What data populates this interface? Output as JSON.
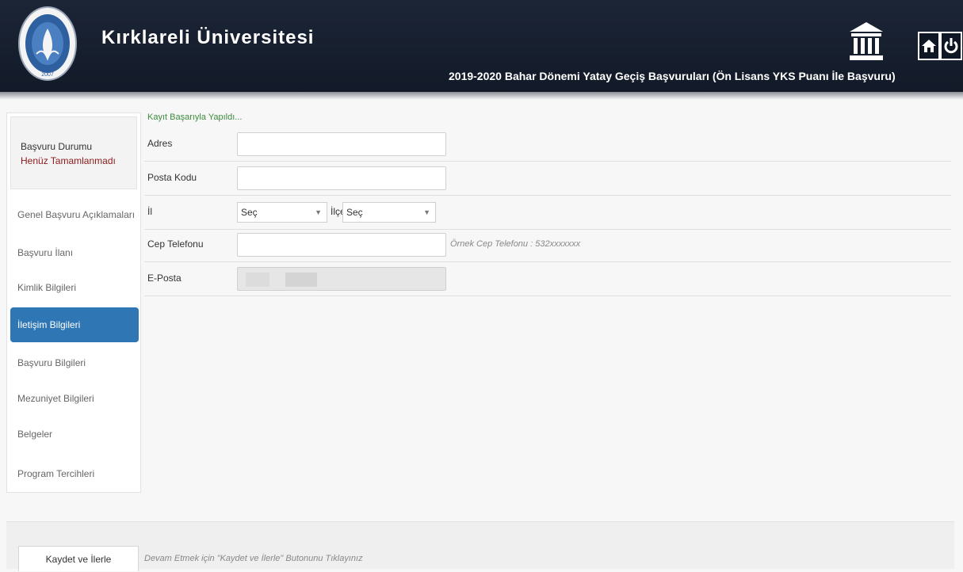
{
  "header": {
    "site_title": "Kırklareli Üniversitesi",
    "application_title": "2019-2020 Bahar Dönemi Yatay Geçiş Başvuruları (Ön Lisans YKS Puanı İle Başvuru)",
    "logo_year": "2007"
  },
  "colors": {
    "header_bg": "#141c2b",
    "active_nav": "#2f76b4",
    "success_text": "#3c8c3c",
    "status_text": "#8b1a1a"
  },
  "sidebar": {
    "status_label": "Başvuru Durumu",
    "status_value": "Henüz Tamamlanmadı",
    "items": [
      {
        "label": "Genel Başvuru Açıklamaları",
        "active": false
      },
      {
        "label": "Başvuru İlanı",
        "active": false
      },
      {
        "label": "Kimlik Bilgileri",
        "active": false
      },
      {
        "label": "İletişim Bilgileri",
        "active": true
      },
      {
        "label": "Başvuru Bilgileri",
        "active": false
      },
      {
        "label": "Mezuniyet Bilgileri",
        "active": false
      },
      {
        "label": "Belgeler",
        "active": false
      },
      {
        "label": "Program Tercihleri",
        "active": false
      }
    ]
  },
  "form": {
    "success_message": "Kayıt Başarıyla Yapıldı...",
    "address_label": "Adres",
    "address_value": "",
    "postal_label": "Posta Kodu",
    "postal_value": "",
    "province_label": "İl",
    "province_selected": "Seç",
    "district_label": "İlçe",
    "district_selected": "Seç",
    "phone_label": "Cep Telefonu",
    "phone_value": "",
    "phone_hint": "Örnek Cep Telefonu : 532xxxxxxx",
    "email_label": "E-Posta"
  },
  "footer": {
    "save_label": "Kaydet ve İlerle",
    "hint": "Devam Etmek için \"Kaydet ve İlerle\" Butonunu Tıklayınız"
  }
}
